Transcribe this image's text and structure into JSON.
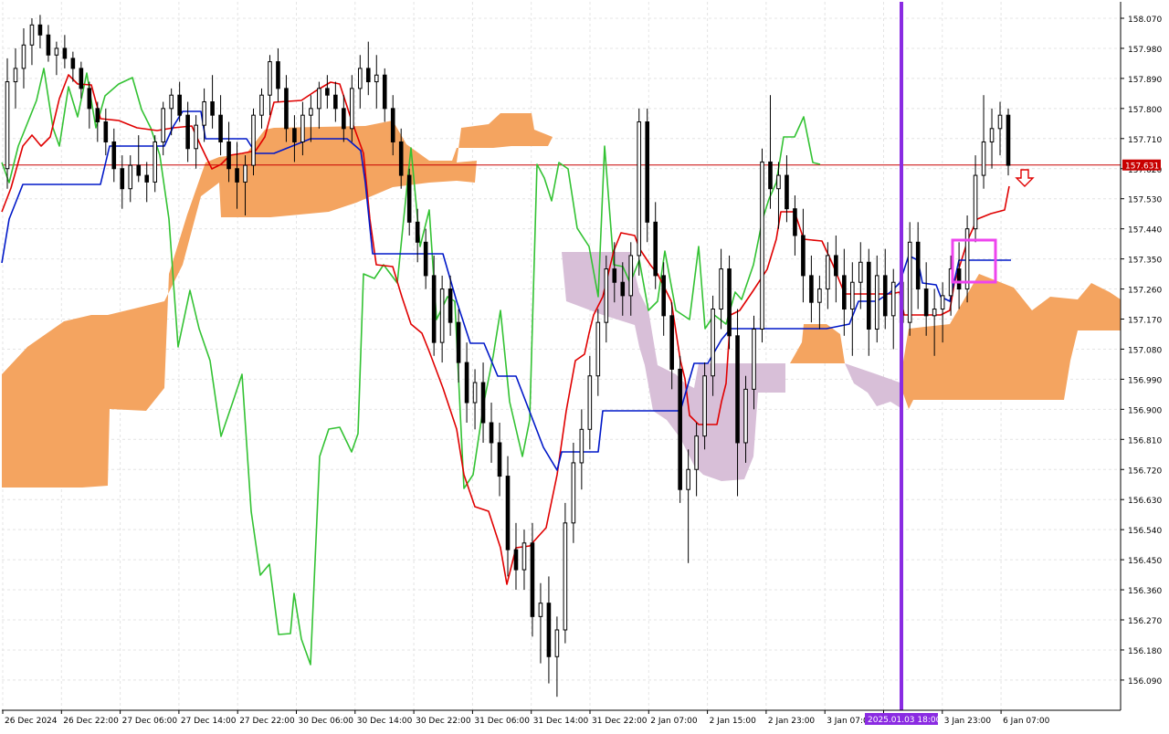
{
  "chart_data": {
    "type": "candlestick",
    "title": "",
    "y_ticks": [
      "158.070",
      "157.980",
      "157.890",
      "157.800",
      "157.710",
      "157.620",
      "157.530",
      "157.440",
      "157.350",
      "157.260",
      "157.170",
      "157.080",
      "156.990",
      "156.900",
      "156.810",
      "156.720",
      "156.630",
      "156.540",
      "156.450",
      "156.360",
      "156.270",
      "156.180",
      "156.090"
    ],
    "x_ticks": [
      "26 Dec 2024",
      "26 Dec 22:00",
      "27 Dec 06:00",
      "27 Dec 14:00",
      "27 Dec 22:00",
      "30 Dec 06:00",
      "30 Dec 14:00",
      "30 Dec 22:00",
      "31 Dec 06:00",
      "31 Dec 14:00",
      "31 Dec 22:00",
      "2 Jan 07:00",
      "2 Jan 15:00",
      "2 Jan 23:00",
      "3 Jan 07:00",
      "2025.01.03 18:00",
      "3 Jan 23:00",
      "6 Jan 07:00"
    ],
    "ylim": [
      156.04,
      158.08
    ],
    "current_price": "157.631",
    "current_value": 157.631,
    "vline_label": "2025.01.03 18:00",
    "grid": true,
    "colors": {
      "background": "#ffffff",
      "grid": "#e4e4e4",
      "candle": "#000000",
      "tenkan": "#e00000",
      "kijun": "#0018c8",
      "chikou": "#33c233",
      "cloud_bull": "#f4a460",
      "cloud_bear": "#d8bfd8",
      "vline": "#8a2be2",
      "highlight_box": "#ee44ee",
      "arrow": "#e00000",
      "price_tag": "#c80000"
    }
  }
}
